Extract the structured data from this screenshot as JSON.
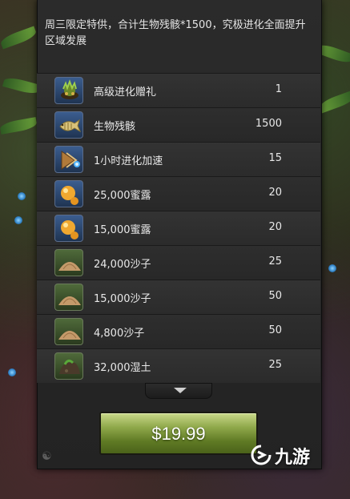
{
  "offer": {
    "description": "周三限定特供，合计生物残骸*1500，究极进化全面提升区域发展"
  },
  "items": [
    {
      "name": "高级进化赠礼",
      "qty": "1",
      "icon": "gift-icon"
    },
    {
      "name": "生物残骸",
      "qty": "1500",
      "icon": "fish-skeleton-icon"
    },
    {
      "name": "1小时进化加速",
      "qty": "15",
      "icon": "speedup-arrow-icon"
    },
    {
      "name": "25,000蜜露",
      "qty": "20",
      "icon": "honeydew-icon"
    },
    {
      "name": "15,000蜜露",
      "qty": "20",
      "icon": "honeydew-icon"
    },
    {
      "name": "24,000沙子",
      "qty": "25",
      "icon": "sand-pile-icon"
    },
    {
      "name": "15,000沙子",
      "qty": "50",
      "icon": "sand-pile-icon"
    },
    {
      "name": "4,800沙子",
      "qty": "50",
      "icon": "sand-pile-icon"
    },
    {
      "name": "32,000湿土",
      "qty": "25",
      "icon": "wet-soil-icon"
    }
  ],
  "buy": {
    "price": "$19.99"
  },
  "watermark": {
    "text": "九游"
  },
  "colors": {
    "panel": "#2b2b2b",
    "icon_bg": "#2d4a73",
    "buy_green": "#7a9638",
    "text": "#e8e8e8"
  }
}
